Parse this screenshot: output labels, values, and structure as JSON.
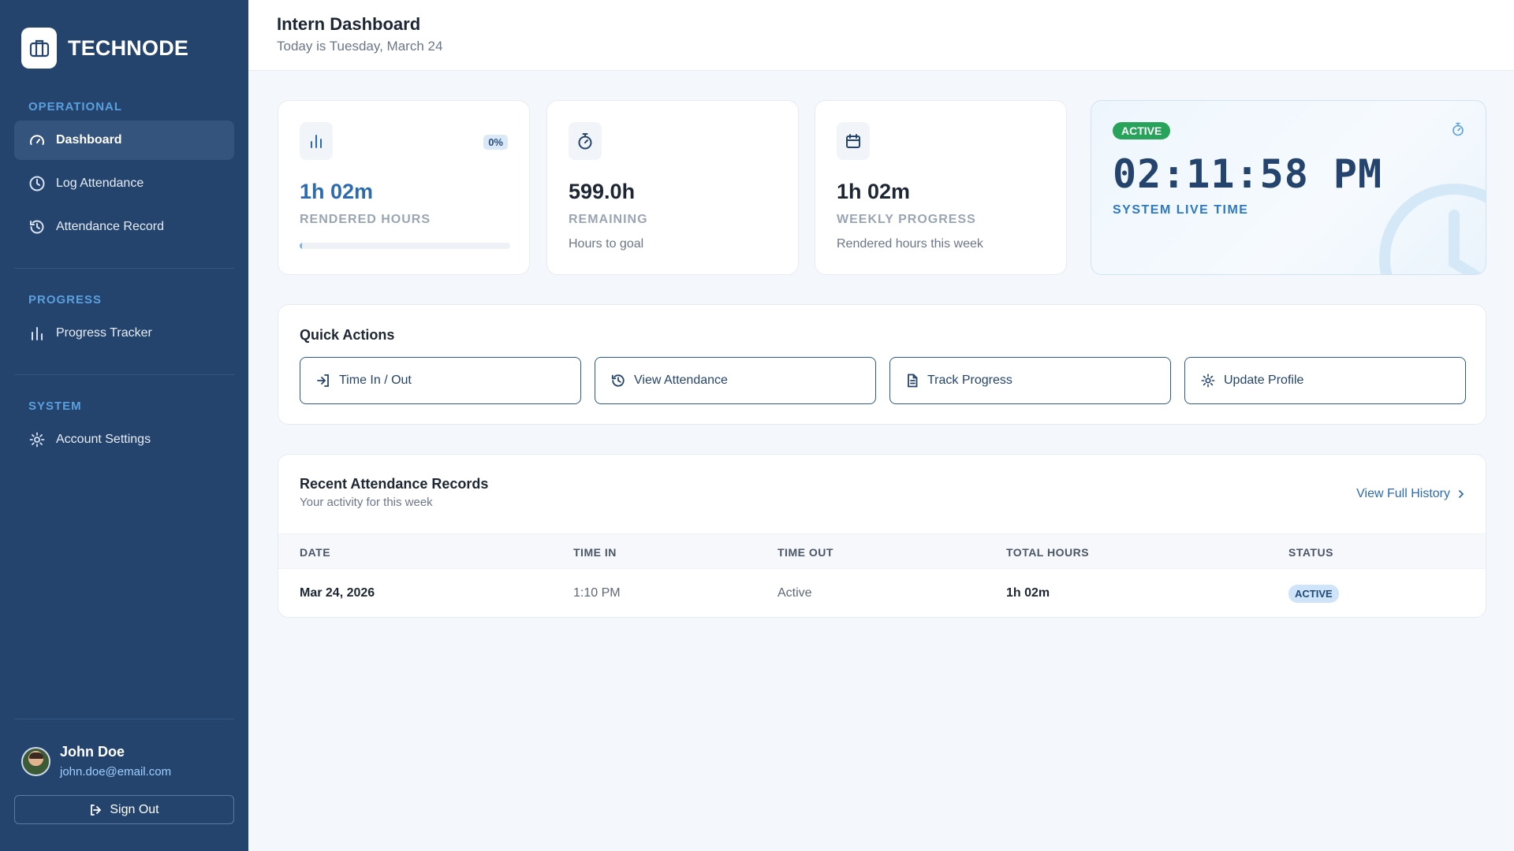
{
  "brand": {
    "name": "TECHNODE"
  },
  "sidebar": {
    "sections": [
      {
        "title": "OPERATIONAL",
        "items": [
          {
            "label": "Dashboard"
          },
          {
            "label": "Log Attendance"
          },
          {
            "label": "Attendance Record"
          }
        ]
      },
      {
        "title": "PROGRESS",
        "items": [
          {
            "label": "Progress Tracker"
          }
        ]
      },
      {
        "title": "SYSTEM",
        "items": [
          {
            "label": "Account Settings"
          }
        ]
      }
    ],
    "active_item": "Dashboard",
    "user": {
      "name": "John Doe",
      "email": "john.doe@email.com"
    },
    "sign_out_label": "Sign Out"
  },
  "header": {
    "title": "Intern Dashboard",
    "subtitle": "Today is Tuesday, March 24"
  },
  "stats": {
    "rendered": {
      "value": "1h 02m",
      "label": "RENDERED HOURS",
      "percent_badge": "0%",
      "progress_fraction": 0.0
    },
    "remaining": {
      "value": "599.0h",
      "label": "REMAINING",
      "sub": "Hours to goal"
    },
    "weekly": {
      "value": "1h 02m",
      "label": "WEEKLY PROGRESS",
      "sub": "Rendered hours this week"
    }
  },
  "live": {
    "badge": "ACTIVE",
    "time": "02:11:58 PM",
    "label": "SYSTEM LIVE TIME"
  },
  "quick_actions": {
    "title": "Quick Actions",
    "buttons": [
      {
        "label": "Time In / Out"
      },
      {
        "label": "View Attendance"
      },
      {
        "label": "Track Progress"
      },
      {
        "label": "Update Profile"
      }
    ]
  },
  "records": {
    "title": "Recent Attendance Records",
    "subtitle": "Your activity for this week",
    "view_history_label": "View Full History",
    "columns": [
      "DATE",
      "TIME IN",
      "TIME OUT",
      "TOTAL HOURS",
      "STATUS"
    ],
    "rows": [
      {
        "date": "Mar 24, 2026",
        "time_in": "1:10 PM",
        "time_out": "Active",
        "total_hours": "1h 02m",
        "status": "ACTIVE"
      }
    ]
  },
  "colors": {
    "sidebar_bg": "#24446e",
    "accent_blue": "#2d6bb0",
    "active_green": "#27a35a",
    "section_title": "#5aa0df"
  }
}
